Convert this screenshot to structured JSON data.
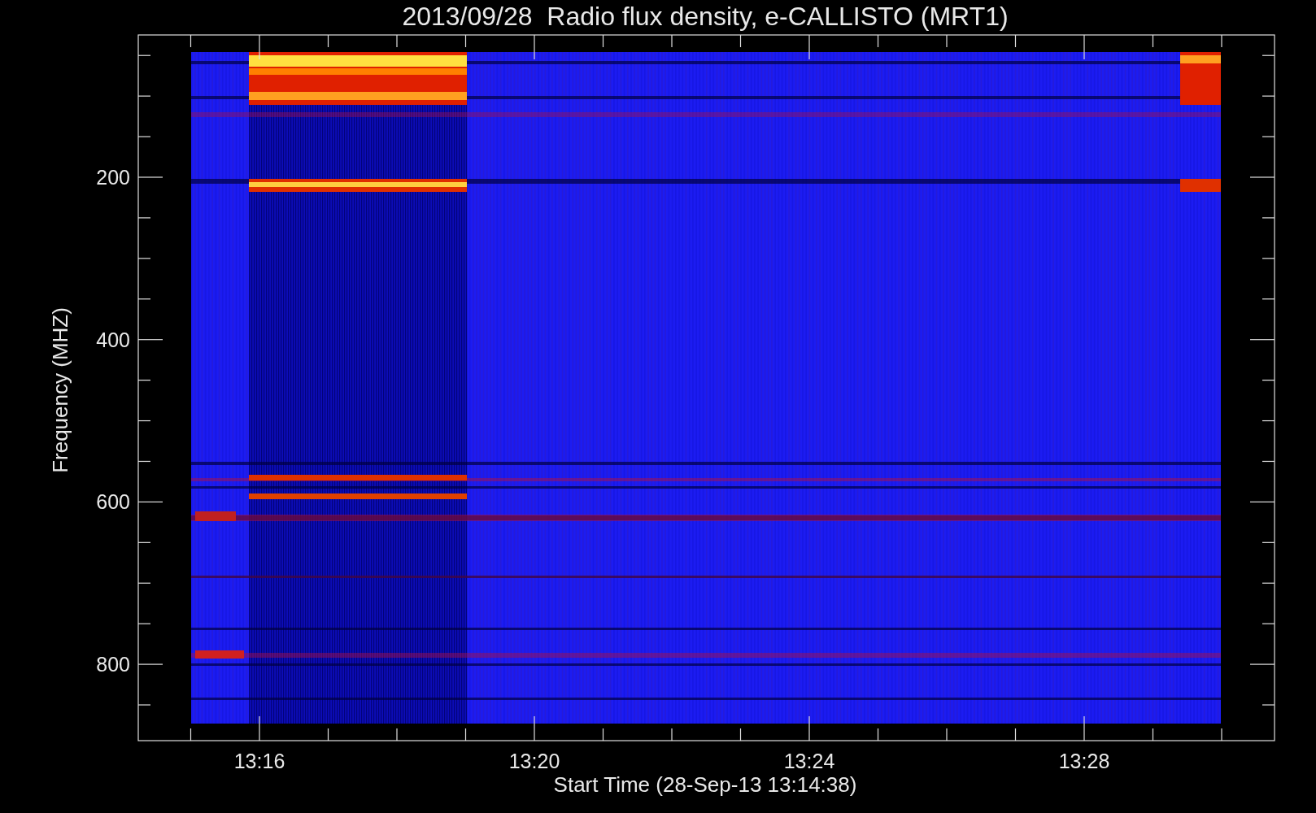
{
  "plot": {
    "title": "2013/09/28  Radio flux density, e-CALLISTO (MRT1)",
    "y_axis": {
      "label": "Frequency (MHZ)",
      "ticks": [
        "200",
        "400",
        "600",
        "800"
      ]
    },
    "x_axis": {
      "label": "Start Time (28-Sep-13 13:14:38)",
      "ticks": [
        "13:16",
        "13:20",
        "13:24",
        "13:28"
      ]
    }
  }
}
